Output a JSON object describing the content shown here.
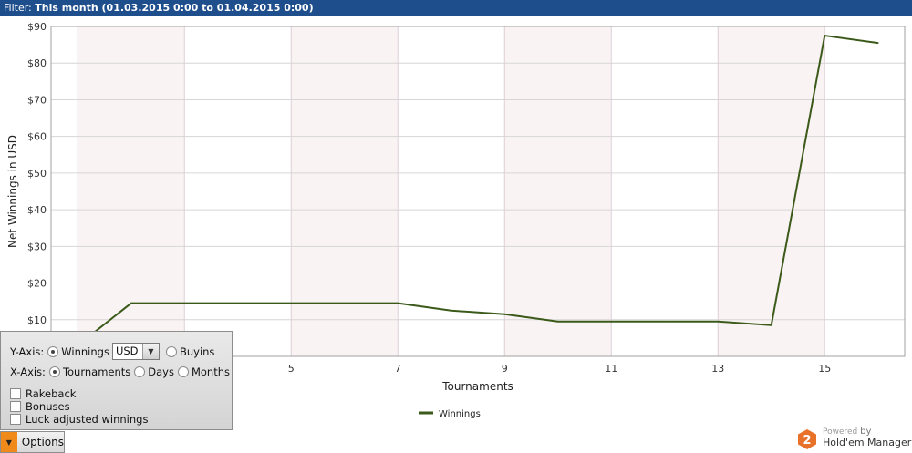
{
  "filter": {
    "label": "Filter:",
    "value": "This month (01.03.2015 0:00 to 01.04.2015 0:00)"
  },
  "chart_data": {
    "type": "line",
    "xlabel": "Tournaments",
    "ylabel": "Net Winnings in USD",
    "xlim": [
      0.5,
      16.5
    ],
    "ylim": [
      0,
      90
    ],
    "x_ticks": [
      5,
      7,
      9,
      11,
      13,
      15
    ],
    "y_ticks": [
      10,
      20,
      30,
      40,
      50,
      60,
      70,
      80,
      90
    ],
    "y_tick_labels": [
      "$10",
      "$20",
      "$30",
      "$40",
      "$50",
      "$60",
      "$70",
      "$80",
      "$90"
    ],
    "grid": true,
    "legend_position": "bottom-center",
    "series": [
      {
        "name": "Winnings",
        "color": "#3b5a1a",
        "x": [
          1,
          2,
          3,
          4,
          5,
          6,
          7,
          8,
          9,
          10,
          11,
          12,
          13,
          14,
          15,
          16
        ],
        "values": [
          3,
          14.5,
          14.5,
          14.5,
          14.5,
          14.5,
          14.5,
          12.5,
          11.5,
          9.5,
          9.5,
          9.5,
          9.5,
          8.5,
          87.5,
          85.5
        ]
      }
    ]
  },
  "options": {
    "yaxis_label": "Y-Axis:",
    "winnings_label": "Winnings",
    "currency_value": "USD",
    "buyins_label": "Buyins",
    "xaxis_label": "X-Axis:",
    "tournaments_label": "Tournaments",
    "days_label": "Days",
    "months_label": "Months",
    "rakeback_label": "Rakeback",
    "bonuses_label": "Bonuses",
    "luck_label": "Luck adjusted winnings",
    "button_label": "Options",
    "dropdown_icon": "chevron-down-icon"
  },
  "branding": {
    "powered": "Powered",
    "by": "by",
    "name": "Hold'em Manager",
    "badge": "2",
    "badge_color": "#e8722a"
  }
}
